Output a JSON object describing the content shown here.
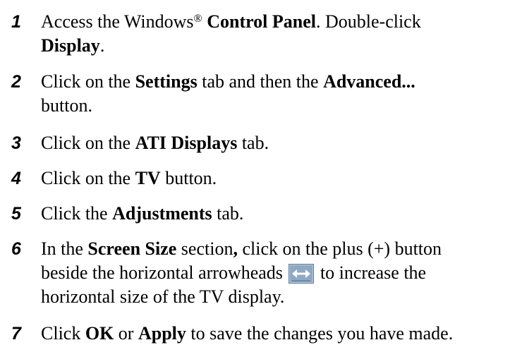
{
  "steps": [
    {
      "number": "1",
      "parts": {
        "a": "Access the Windows",
        "reg": "®",
        "b": "Control Panel",
        "c": ". Double-click",
        "d": "Display",
        "e": "."
      }
    },
    {
      "number": "2",
      "parts": {
        "a": "Click on the",
        "b": "Settings",
        "c": "tab and then the",
        "d": "Advanced...",
        "e": "button."
      }
    },
    {
      "number": "3",
      "parts": {
        "a": "Click on the",
        "b": "ATI Displays",
        "c": "tab."
      }
    },
    {
      "number": "4",
      "parts": {
        "a": "Click on the",
        "b": "TV",
        "c": "button."
      }
    },
    {
      "number": "5",
      "parts": {
        "a": "Click the",
        "b": "Adjustments",
        "c": "tab."
      }
    },
    {
      "number": "6",
      "parts": {
        "a": "In the",
        "b": "Screen Size",
        "c": "section",
        "d": ",",
        "e": "click on the plus (+) button",
        "f": "beside the horizontal arrowheads",
        "icon": "horizontal-arrowheads-icon",
        "g": "to increase the",
        "h": "horizontal size of the TV display."
      }
    },
    {
      "number": "7",
      "parts": {
        "a": "Click",
        "b": "OK",
        "c": "or",
        "d": "Apply",
        "e": "to save the changes you have made."
      }
    }
  ],
  "colors": {
    "text": "#000000",
    "icon_background": "#8fa9c4",
    "icon_arrow": "#ffffff"
  }
}
